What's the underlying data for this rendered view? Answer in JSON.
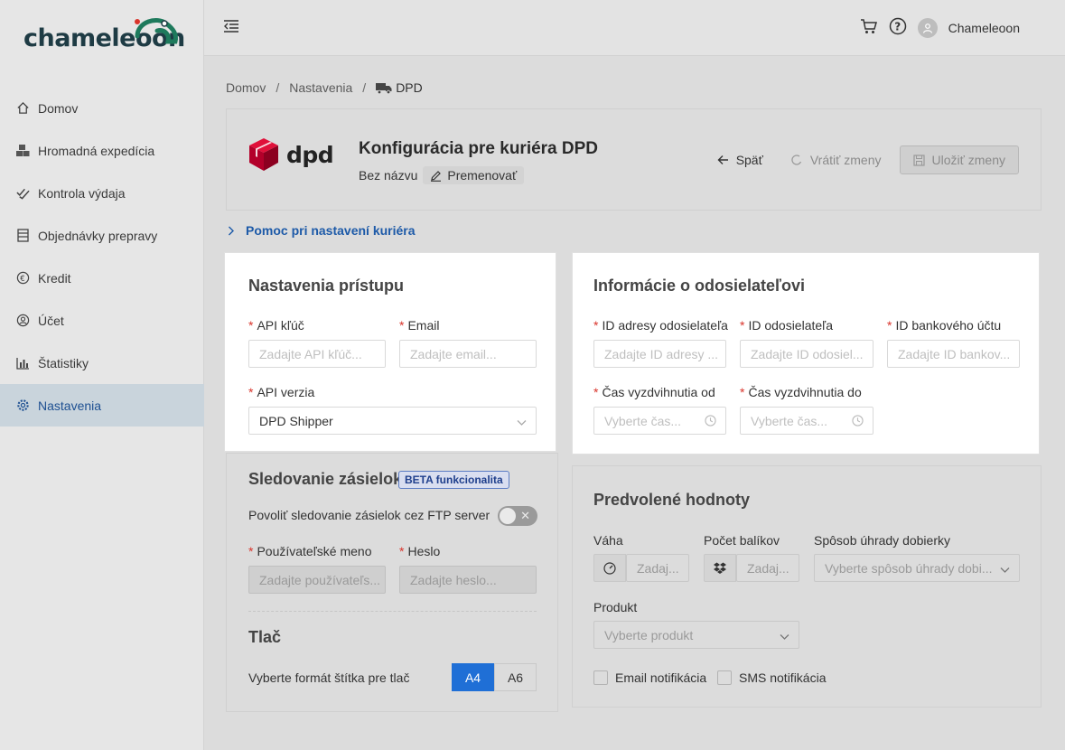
{
  "app": {
    "logo_text": "chameleoon"
  },
  "sidebar": {
    "items": [
      {
        "label": "Domov",
        "icon": "home-icon"
      },
      {
        "label": "Hromadná expedícia",
        "icon": "boxes-icon"
      },
      {
        "label": "Kontrola výdaja",
        "icon": "double-check-icon"
      },
      {
        "label": "Objednávky prepravy",
        "icon": "list-icon"
      },
      {
        "label": "Kredit",
        "icon": "euro-icon"
      },
      {
        "label": "Účet",
        "icon": "user-circle-icon"
      },
      {
        "label": "Štatistiky",
        "icon": "bar-chart-icon"
      },
      {
        "label": "Nastavenia",
        "icon": "gear-icon",
        "active": true
      }
    ]
  },
  "topbar": {
    "user_name": "Chameleoon"
  },
  "breadcrumb": {
    "home": "Domov",
    "settings": "Nastavenia",
    "current": "DPD"
  },
  "header": {
    "logo_word": "dpd",
    "title": "Konfigurácia pre kuriéra DPD",
    "subtitle": "Bez názvu",
    "rename_label": "Premenovať",
    "back_label": "Späť",
    "revert_label": "Vrátiť zmeny",
    "save_label": "Uložiť zmeny"
  },
  "help": {
    "label": "Pomoc pri nastavení kuriéra"
  },
  "access": {
    "title": "Nastavenia prístupu",
    "api_key_label": "API kľúč",
    "api_key_placeholder": "Zadajte API kľúč...",
    "email_label": "Email",
    "email_placeholder": "Zadajte email...",
    "api_version_label": "API verzia",
    "api_version_value": "DPD Shipper"
  },
  "sender": {
    "title": "Informácie o odosielateľovi",
    "address_id_label": "ID adresy odosielateľa",
    "address_id_placeholder": "Zadajte ID adresy ...",
    "sender_id_label": "ID odosielateľa",
    "sender_id_placeholder": "Zadajte ID odosiel...",
    "bank_id_label": "ID bankového účtu",
    "bank_id_placeholder": "Zadajte ID bankov...",
    "pickup_from_label": "Čas vyzdvihnutia od",
    "pickup_from_placeholder": "Vyberte čas...",
    "pickup_to_label": "Čas vyzdvihnutia do",
    "pickup_to_placeholder": "Vyberte čas..."
  },
  "tracking": {
    "title": "Sledovanie zásielok",
    "badge": "BETA funkcionalita",
    "ftp_label": "Povoliť sledovanie zásielok cez FTP server",
    "ftp_enabled": false,
    "toggle_symbol": "✕",
    "username_label": "Používateľské meno",
    "username_placeholder": "Zadajte používateľs...",
    "password_label": "Heslo",
    "password_placeholder": "Zadajte heslo..."
  },
  "print": {
    "title": "Tlač",
    "format_label": "Vyberte formát štítka pre tlač",
    "options": [
      "A4",
      "A6"
    ],
    "selected": "A4"
  },
  "defaults": {
    "title": "Predvolené hodnoty",
    "weight_label": "Váha",
    "weight_placeholder": "Zadaj...",
    "packages_label": "Počet balíkov",
    "packages_placeholder": "Zadaj...",
    "cod_label": "Spôsob úhrady dobierky",
    "cod_placeholder": "Vyberte spôsob úhrady dobi...",
    "product_label": "Produkt",
    "product_placeholder": "Vyberte produkt",
    "email_notif_label": "Email notifikácia",
    "sms_notif_label": "SMS notifikácia"
  },
  "colors": {
    "accent": "#1f6fd6",
    "required": "#d9342b",
    "dpd_red": "#dc0032",
    "logo_green": "#1e7a5c"
  }
}
